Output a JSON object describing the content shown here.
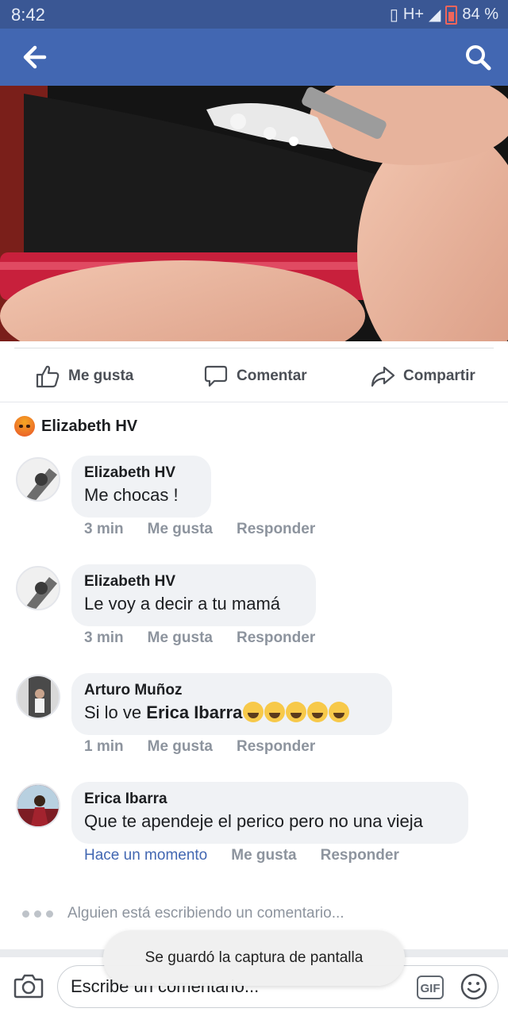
{
  "status_bar": {
    "time": "8:42",
    "network": "H+",
    "battery": "84 %"
  },
  "header": {
    "back_icon": "arrow-left-icon",
    "search_icon": "search-icon"
  },
  "actions": {
    "like": "Me gusta",
    "comment": "Comentar",
    "share": "Compartir"
  },
  "reaction": {
    "reactor_name": "Elizabeth HV",
    "icon": "angry-reaction-icon"
  },
  "comments": [
    {
      "name": "Elizabeth HV",
      "text": "Me  chocas !",
      "time": "3 min",
      "like": "Me gusta",
      "reply": "Responder"
    },
    {
      "name": "Elizabeth HV",
      "text": "Le voy a decir a tu mamá",
      "time": "3 min",
      "like": "Me gusta",
      "reply": "Responder"
    },
    {
      "name": "Arturo Muñoz",
      "text_prefix": "Si lo ve ",
      "mention": "Erica Ibarra",
      "time": "1 min",
      "like": "Me gusta",
      "reply": "Responder"
    },
    {
      "name": "Erica Ibarra",
      "text": "Que te apendeje el perico pero no una vieja",
      "time": "Hace un momento",
      "like": "Me gusta",
      "reply": "Responder"
    }
  ],
  "typing": {
    "text": "Alguien está escribiendo un comentario..."
  },
  "composer": {
    "placeholder": "Escribe un comentario...",
    "gif_label": "GIF"
  },
  "toast": {
    "text": "Se guardó la captura de pantalla"
  },
  "colors": {
    "brand": "#4267b2",
    "status_bar": "#3a5794",
    "bubble": "#f0f2f5"
  }
}
